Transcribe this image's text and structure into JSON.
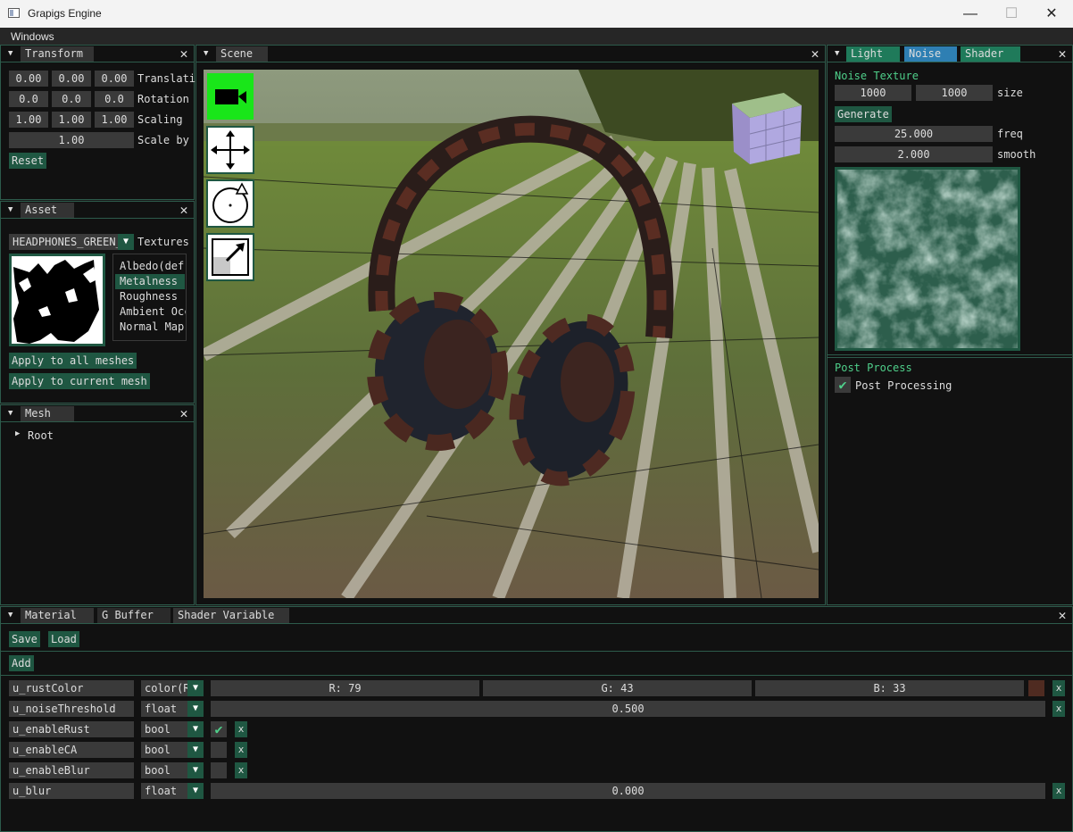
{
  "window": {
    "title": "Grapigs Engine",
    "minimize": "—",
    "maximize": "☐",
    "close": "✕"
  },
  "menu": {
    "windows": "Windows"
  },
  "transform": {
    "tab": "Transform",
    "translation": [
      "0.00",
      "0.00",
      "0.00"
    ],
    "translation_label": "Translati",
    "rotation": [
      "0.0",
      "0.0",
      "0.0"
    ],
    "rotation_label": "Rotation",
    "scaling": [
      "1.00",
      "1.00",
      "1.00"
    ],
    "scaling_label": "Scaling",
    "scale_by": "1.00",
    "scale_by_label": "Scale by",
    "reset": "Reset"
  },
  "asset": {
    "tab": "Asset",
    "selected": "HEADPHONES_GREEN_",
    "textures_label": "Textures",
    "textures": [
      "Albedo(def.",
      "Metalness",
      "Roughness",
      "Ambient Occ",
      "Normal Map"
    ],
    "selected_texture_index": 1,
    "apply_all": "Apply to all meshes",
    "apply_current": "Apply to current mesh"
  },
  "mesh": {
    "tab": "Mesh",
    "root": "Root"
  },
  "scene": {
    "tab": "Scene"
  },
  "right": {
    "tabs": [
      "Light",
      "Noise",
      "Shader"
    ],
    "noise_title": "Noise Texture",
    "size": [
      "1000",
      "1000"
    ],
    "size_label": "size",
    "generate": "Generate",
    "freq": "25.000",
    "freq_label": "freq",
    "smooth": "2.000",
    "smooth_label": "smooth",
    "post_title": "Post Process",
    "post_processing": "Post Processing",
    "post_checked": true
  },
  "bottom": {
    "tabs": [
      "Material",
      "G Buffer",
      "Shader Variable"
    ],
    "save": "Save",
    "load": "Load",
    "add": "Add",
    "rows": [
      {
        "name": "u_rustColor",
        "type": "color(R",
        "r": "R: 79",
        "g": "G: 43",
        "b": "B: 33",
        "swatch": "#4f2b21"
      },
      {
        "name": "u_noiseThreshold",
        "type": "float",
        "value": "0.500"
      },
      {
        "name": "u_enableRust",
        "type": "bool",
        "checked": true
      },
      {
        "name": "u_enableCA",
        "type": "bool",
        "checked": false
      },
      {
        "name": "u_enableBlur",
        "type": "bool",
        "checked": false
      },
      {
        "name": "u_blur",
        "type": "float",
        "value": "0.000"
      }
    ],
    "x": "x"
  },
  "colors": {
    "accent": "#1f5742",
    "border": "#2d5b4b",
    "title_green": "#4fcf8a",
    "cam_green": "#19e619"
  }
}
